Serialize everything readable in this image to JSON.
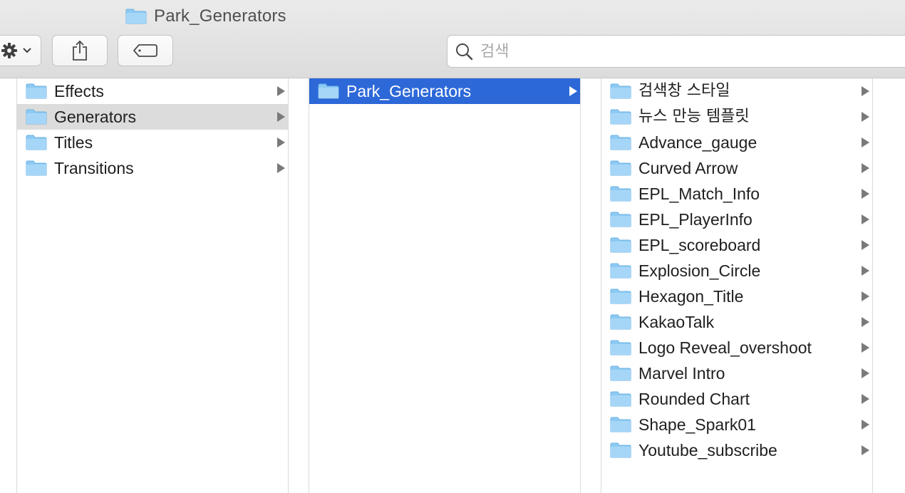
{
  "window": {
    "title": "Park_Generators"
  },
  "toolbar": {
    "action_icon": "gear-icon",
    "action_chevron": "chevron-down-icon",
    "share_icon": "share-icon",
    "tag_icon": "tag-icon"
  },
  "search": {
    "placeholder": "검색",
    "value": ""
  },
  "columns": {
    "col1": {
      "items": [
        {
          "label": "Effects"
        },
        {
          "label": "Generators"
        },
        {
          "label": "Titles"
        },
        {
          "label": "Transitions"
        }
      ]
    },
    "col2": {
      "items": [
        {
          "label": "Park_Generators"
        }
      ]
    },
    "col3": {
      "items": [
        {
          "label": "검색창 스타일"
        },
        {
          "label": "뉴스 만능 템플릿"
        },
        {
          "label": "Advance_gauge"
        },
        {
          "label": "Curved Arrow"
        },
        {
          "label": "EPL_Match_Info"
        },
        {
          "label": "EPL_PlayerInfo"
        },
        {
          "label": "EPL_scoreboard"
        },
        {
          "label": "Explosion_Circle"
        },
        {
          "label": "Hexagon_Title"
        },
        {
          "label": "KakaoTalk"
        },
        {
          "label": "Logo Reveal_overshoot"
        },
        {
          "label": "Marvel Intro"
        },
        {
          "label": "Rounded Chart"
        },
        {
          "label": "Shape_Spark01"
        },
        {
          "label": "Youtube_subscribe"
        }
      ]
    }
  },
  "colors": {
    "selection_blue": "#2d68d8",
    "selection_gray": "#dcdcdc",
    "folder_blue": "#7ec4f2"
  }
}
